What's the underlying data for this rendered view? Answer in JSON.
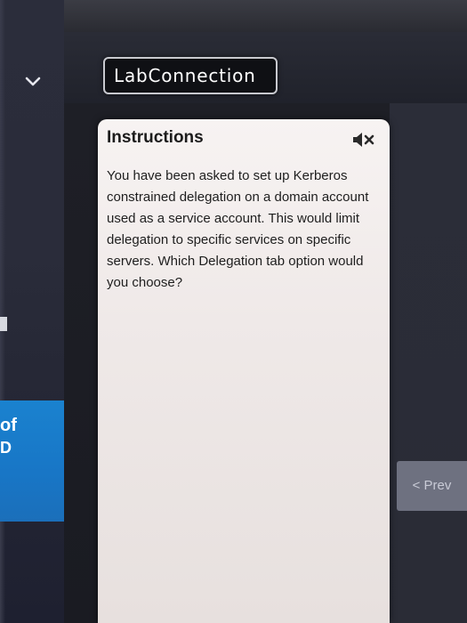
{
  "header": {
    "app_button_label": "LabConnection"
  },
  "instructions": {
    "title": "Instructions",
    "body": "You have been asked to set up Kerberos constrained delegation on a domain account used as a service account. This would limit delegation to specific services on specific servers. Which Delegation tab option would you choose?",
    "mute_icon": "speaker-mute-icon"
  },
  "sidebar": {
    "blue_text_line1": "of",
    "blue_text_line2": "D",
    "expand_icon": "chevron-down-icon"
  },
  "navigation": {
    "prev_label": "< Prev"
  },
  "colors": {
    "accent_blue": "#1a7fcc",
    "card_background": "#f2eded",
    "page_background": "#1b1d24"
  }
}
